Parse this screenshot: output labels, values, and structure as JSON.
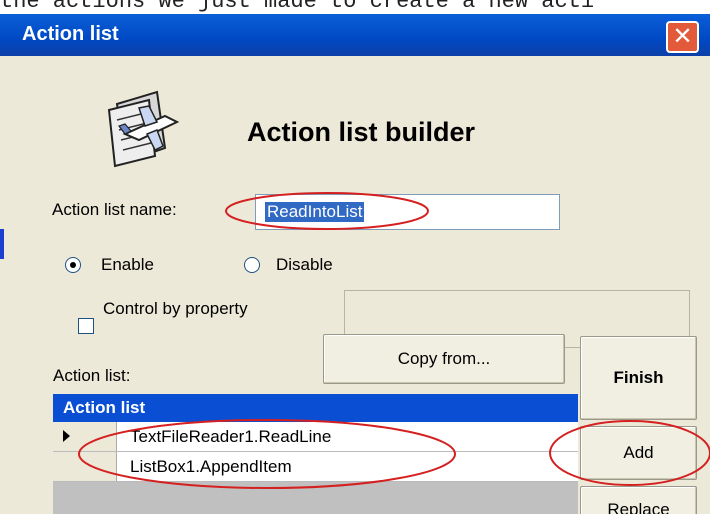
{
  "background_text": "the actions we just made to create a new acti",
  "window": {
    "title": "Action list",
    "close_glyph": "✕"
  },
  "header": {
    "icon": "airplane-document-icon",
    "title": "Action list builder"
  },
  "form": {
    "name_label": "Action list name:",
    "name_value": "ReadIntoList",
    "enable_label": "Enable",
    "disable_label": "Disable",
    "selected_radio": "Enable",
    "control_label": "Control by property",
    "control_checked": false,
    "property_value": ""
  },
  "actions": {
    "list_label": "Action list:",
    "copy_from": "Copy from...",
    "finish": "Finish",
    "add": "Add",
    "replace": "Replace",
    "grid_header": "Action list",
    "rows": [
      {
        "text": "TextFileReader1.ReadLine",
        "current": true
      },
      {
        "text": "ListBox1.AppendItem",
        "current": false
      }
    ]
  },
  "colors": {
    "titlebar": "#0054e3",
    "annotation": "#d42020",
    "selection": "#316ac5"
  }
}
